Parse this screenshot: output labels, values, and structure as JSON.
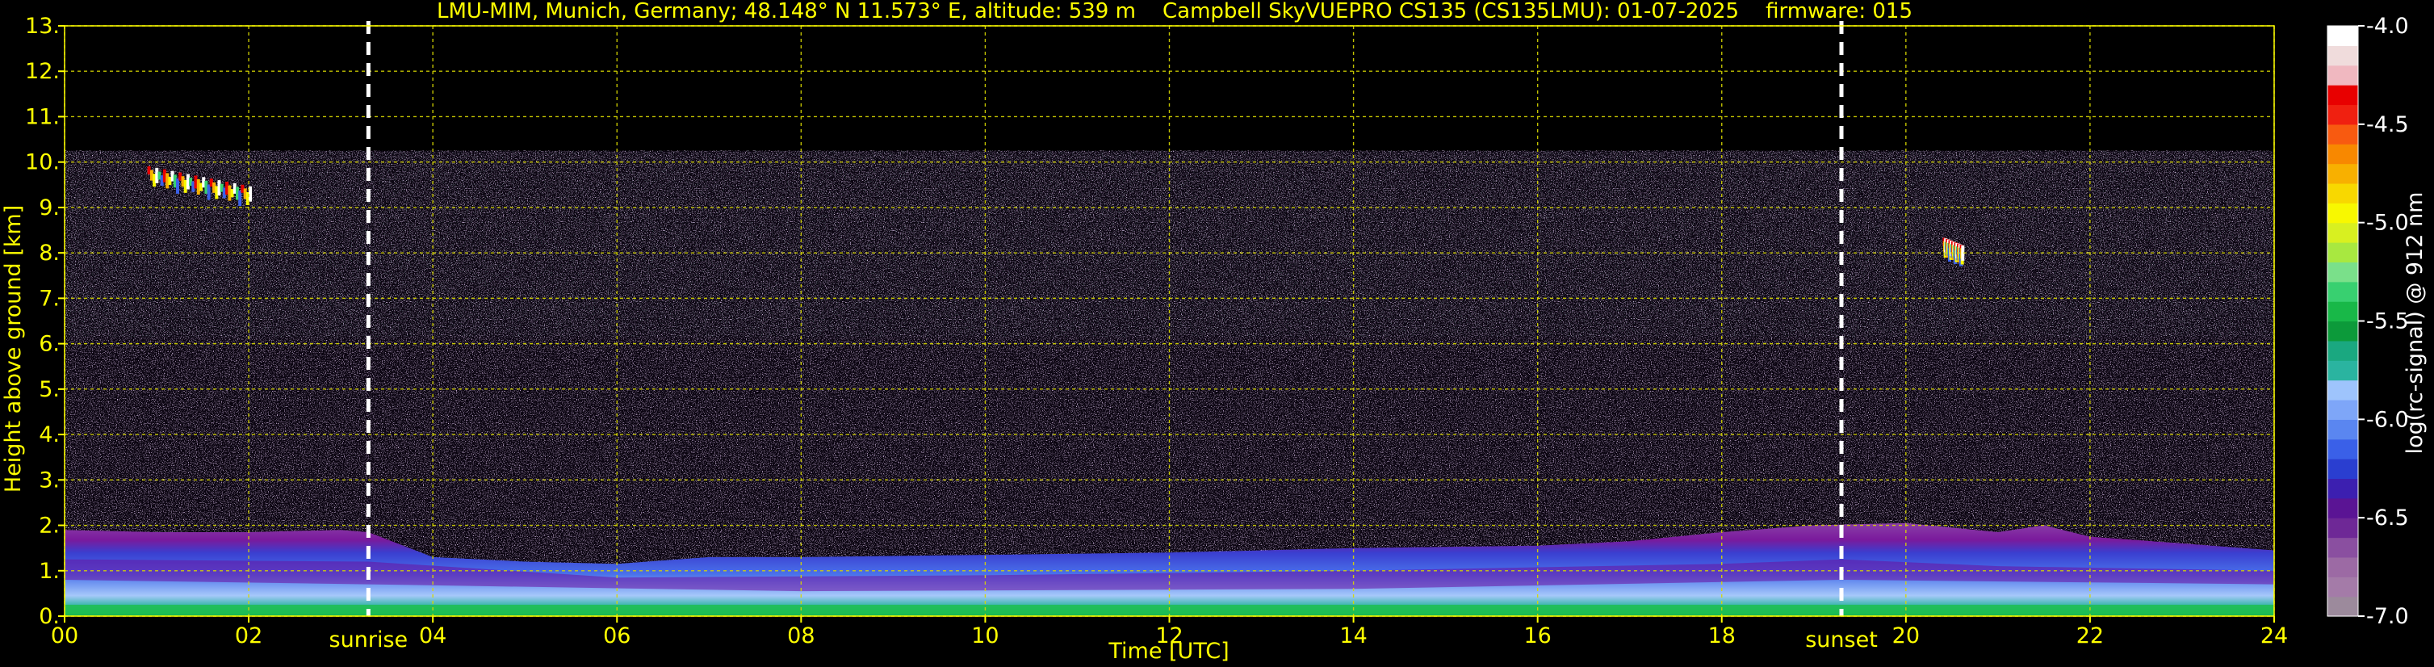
{
  "chart_data": {
    "type": "heatmap",
    "title": "LMU-MIM, Munich, Germany; 48.148° N 11.573° E, altitude: 539 m    Campbell SkyVUEPRO CS135 (CS135LMU): 01-07-2025    firmware: 015",
    "xlabel": "Time [UTC]",
    "ylabel": "Height above ground [km]",
    "xlim": [
      0,
      24
    ],
    "ylim": [
      0,
      13
    ],
    "x_ticks": [
      "00",
      "02",
      "04",
      "06",
      "08",
      "10",
      "12",
      "14",
      "16",
      "18",
      "20",
      "22",
      "24"
    ],
    "y_ticks": [
      "0.",
      "1.",
      "2.",
      "3.",
      "4.",
      "5.",
      "6.",
      "7.",
      "8.",
      "9.",
      "10.",
      "11.",
      "12.",
      "13."
    ],
    "grid": true,
    "data_top_km": 10.25,
    "colorbar": {
      "label": "log(rc-signal) @ 912 nm",
      "range": [
        -7.0,
        -4.0
      ],
      "ticks": [
        "-4.0",
        "-4.5",
        "-5.0",
        "-5.5",
        "-6.0",
        "-6.5",
        "-7.0"
      ],
      "colors": [
        "#9c8a9c",
        "#a47ba8",
        "#9c6aa4",
        "#8a4fa0",
        "#6e2896",
        "#5a1494",
        "#3c1fb0",
        "#2a3ed0",
        "#3a60e8",
        "#5a86f0",
        "#7ea6f8",
        "#9ec4fc",
        "#2ab4a0",
        "#1aa880",
        "#0c9a3a",
        "#18b848",
        "#38d070",
        "#7ae08a",
        "#a8e840",
        "#d8f020",
        "#f8f800",
        "#f8d800",
        "#f8b000",
        "#f88800",
        "#f85a10",
        "#f02010",
        "#e80000",
        "#f0b8c0",
        "#f0dcdc",
        "#ffffff"
      ]
    },
    "events": [
      {
        "label": "sunrise",
        "time": 3.3
      },
      {
        "label": "sunset",
        "time": 19.3
      }
    ],
    "boundary_layer_top_km": [
      [
        0,
        1.9
      ],
      [
        1,
        1.85
      ],
      [
        2,
        1.85
      ],
      [
        3,
        1.9
      ],
      [
        3.3,
        1.85
      ],
      [
        4,
        1.3
      ],
      [
        5,
        1.2
      ],
      [
        6,
        1.15
      ],
      [
        7,
        1.3
      ],
      [
        8,
        1.3
      ],
      [
        10,
        1.35
      ],
      [
        12,
        1.4
      ],
      [
        14,
        1.5
      ],
      [
        16,
        1.55
      ],
      [
        17,
        1.65
      ],
      [
        18,
        1.85
      ],
      [
        19,
        2.0
      ],
      [
        20,
        2.05
      ],
      [
        21,
        1.85
      ],
      [
        21.5,
        2.0
      ],
      [
        22,
        1.75
      ],
      [
        23,
        1.6
      ],
      [
        24,
        1.45
      ]
    ],
    "cloud_features": [
      {
        "t_start": 0.9,
        "t_end": 2.0,
        "h_low_km": 9.2,
        "h_high_km": 10.0
      },
      {
        "t_start": 20.4,
        "t_end": 20.6,
        "h_low_km": 8.0,
        "h_high_km": 8.3
      }
    ],
    "colors": {
      "background": "#000000",
      "text": "#ffff00",
      "grid": "#d8d800",
      "event_line": "#ffffff",
      "colorbar_label": "#ffffff"
    }
  }
}
